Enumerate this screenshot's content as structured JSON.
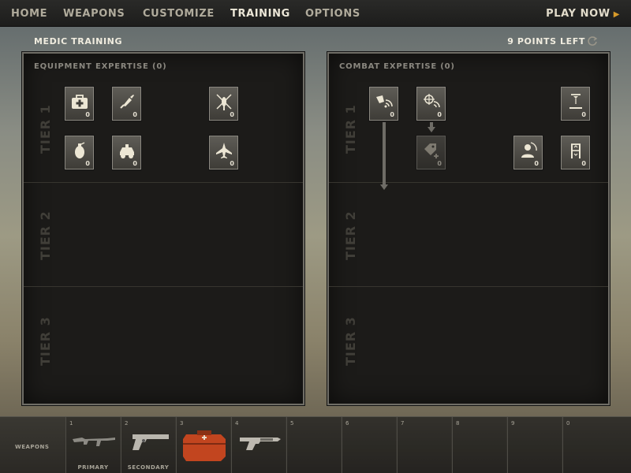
{
  "nav": {
    "items": [
      "HOME",
      "WEAPONS",
      "CUSTOMIZE",
      "TRAINING",
      "OPTIONS"
    ],
    "active": "TRAINING",
    "play_now": "PLAY NOW"
  },
  "header": {
    "title": "MEDIC TRAINING",
    "points": "9 POINTS LEFT"
  },
  "panels": {
    "equipment": {
      "title": "EQUIPMENT EXPERTISE (0)",
      "tiers": [
        "TIER 1",
        "TIER 2",
        "TIER 3"
      ],
      "skills": [
        {
          "icon": "medkit-icon",
          "count": "0"
        },
        {
          "icon": "syringe-icon",
          "count": "0"
        },
        {
          "icon": "helicopter-icon",
          "count": "0"
        },
        {
          "icon": "grenade-icon",
          "count": "0"
        },
        {
          "icon": "vehicle-icon",
          "count": "0"
        },
        {
          "icon": "jet-icon",
          "count": "0"
        }
      ]
    },
    "combat": {
      "title": "COMBAT EXPERTISE (0)",
      "tiers": [
        "TIER 1",
        "TIER 2",
        "TIER 3"
      ],
      "skills": [
        {
          "icon": "signal-boost-icon",
          "count": "0"
        },
        {
          "icon": "target-signal-icon",
          "count": "0"
        },
        {
          "icon": "plus-tag-icon",
          "count": "0"
        },
        {
          "icon": "height-marker-icon",
          "count": "0"
        },
        {
          "icon": "soldier-icon",
          "count": "0"
        },
        {
          "icon": "ladder-icon",
          "count": "0"
        }
      ]
    }
  },
  "bottombar": {
    "label": "WEAPONS",
    "slots": [
      {
        "num": "1",
        "caption": "PRIMARY",
        "icon": "rifle-icon"
      },
      {
        "num": "2",
        "caption": "SECONDARY",
        "icon": "pistol-icon"
      },
      {
        "num": "3",
        "caption": "",
        "icon": "medkit-case-icon"
      },
      {
        "num": "4",
        "caption": "",
        "icon": "defib-gun-icon"
      },
      {
        "num": "5",
        "caption": "",
        "icon": ""
      },
      {
        "num": "6",
        "caption": "",
        "icon": ""
      },
      {
        "num": "7",
        "caption": "",
        "icon": ""
      },
      {
        "num": "8",
        "caption": "",
        "icon": ""
      },
      {
        "num": "9",
        "caption": "",
        "icon": ""
      },
      {
        "num": "0",
        "caption": "",
        "icon": ""
      }
    ]
  },
  "colors": {
    "accent": "#d79a2a",
    "panel_bg": "#1c1b19",
    "case_red": "#c2451f"
  }
}
